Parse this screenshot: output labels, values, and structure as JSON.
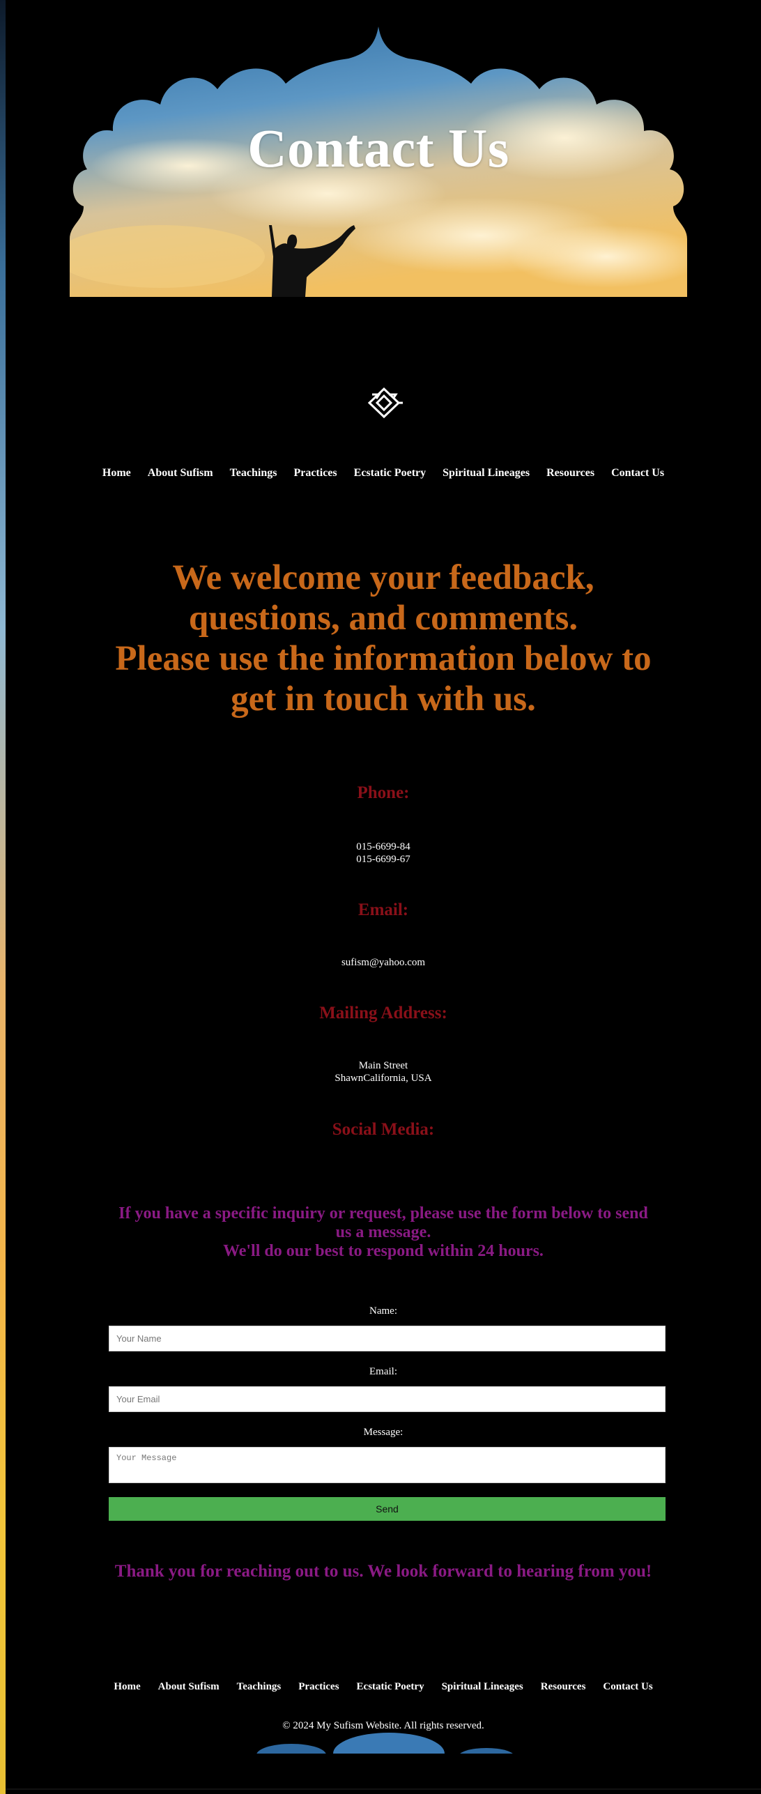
{
  "hero": {
    "title": "Contact Us"
  },
  "nav": {
    "items": [
      {
        "label": "Home"
      },
      {
        "label": "About Sufism"
      },
      {
        "label": "Teachings"
      },
      {
        "label": "Practices"
      },
      {
        "label": "Ecstatic Poetry"
      },
      {
        "label": "Spiritual Lineages"
      },
      {
        "label": "Resources"
      },
      {
        "label": "Contact Us"
      }
    ]
  },
  "intro": {
    "line1": "We welcome your feedback,",
    "line2": "questions, and comments.",
    "line3": "Please use the information below to",
    "line4": "get in touch with us."
  },
  "contact": {
    "phone_heading": "Phone:",
    "phone_1": "015-6699-84",
    "phone_2": "015-6699-67",
    "email_heading": "Email:",
    "email_value": "sufism@yahoo.com",
    "address_heading": "Mailing Address:",
    "address_line1": "Main Street",
    "address_line2": "ShawnCalifornia, USA",
    "social_heading": "Social Media:"
  },
  "inquiry": {
    "line1": "If you have a specific inquiry or request, please use the form below to send us a message.",
    "line2": "We'll do our best to respond within 24 hours."
  },
  "form": {
    "name_label": "Name:",
    "name_placeholder": "Your Name",
    "email_label": "Email:",
    "email_placeholder": "Your Email",
    "message_label": "Message:",
    "message_placeholder": "Your Message",
    "send_label": "Send"
  },
  "thanks": "Thank you for reaching out to us. We look forward to hearing from you!",
  "footer": {
    "copyright": "© 2024 My Sufism Website. All rights reserved."
  },
  "colors": {
    "intro": "#c8681a",
    "section_heading": "#8a1019",
    "inquiry": "#8a1a84",
    "send_button": "#4caf50"
  }
}
